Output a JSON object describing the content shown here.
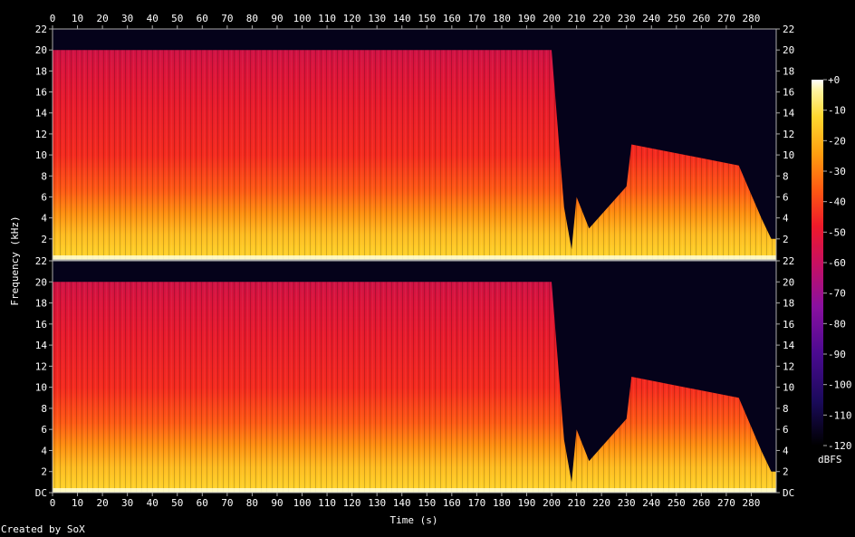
{
  "credit": "Created by SoX",
  "chart_data": {
    "type": "heatmap",
    "title": "",
    "xlabel": "Time (s)",
    "ylabel": "Frequency (kHz)",
    "xlim": [
      0,
      290
    ],
    "ylim": [
      0,
      22
    ],
    "x_ticks": [
      "0",
      "10",
      "20",
      "30",
      "40",
      "50",
      "60",
      "70",
      "80",
      "90",
      "100",
      "110",
      "120",
      "130",
      "140",
      "150",
      "160",
      "170",
      "180",
      "190",
      "200",
      "210",
      "220",
      "230",
      "240",
      "250",
      "260",
      "270",
      "280"
    ],
    "y_ticks": [
      "DC",
      "2",
      "4",
      "6",
      "8",
      "10",
      "12",
      "14",
      "16",
      "18",
      "20",
      "22"
    ],
    "channels": 2,
    "colorbar": {
      "label": "dBFS",
      "ticks": [
        "+0",
        "-10",
        "-20",
        "-30",
        "-40",
        "-50",
        "-60",
        "-70",
        "-80",
        "-90",
        "-100",
        "-110",
        "-120"
      ],
      "range": [
        -120,
        0
      ]
    },
    "palette": [
      "#000000",
      "#1a0a5a",
      "#4a0a90",
      "#8a10a0",
      "#c81060",
      "#ee1a2a",
      "#ff5a12",
      "#ffa010",
      "#ffd830",
      "#fff4a0",
      "#ffffff"
    ],
    "cutoff_khz_profile": [
      {
        "t": 0,
        "khz": 20
      },
      {
        "t": 200,
        "khz": 20
      },
      {
        "t": 205,
        "khz": 5
      },
      {
        "t": 208,
        "khz": 1
      },
      {
        "t": 210,
        "khz": 6
      },
      {
        "t": 215,
        "khz": 3
      },
      {
        "t": 230,
        "khz": 7
      },
      {
        "t": 232,
        "khz": 11
      },
      {
        "t": 275,
        "khz": 9
      },
      {
        "t": 284,
        "khz": 4
      },
      {
        "t": 288,
        "khz": 2
      }
    ]
  }
}
